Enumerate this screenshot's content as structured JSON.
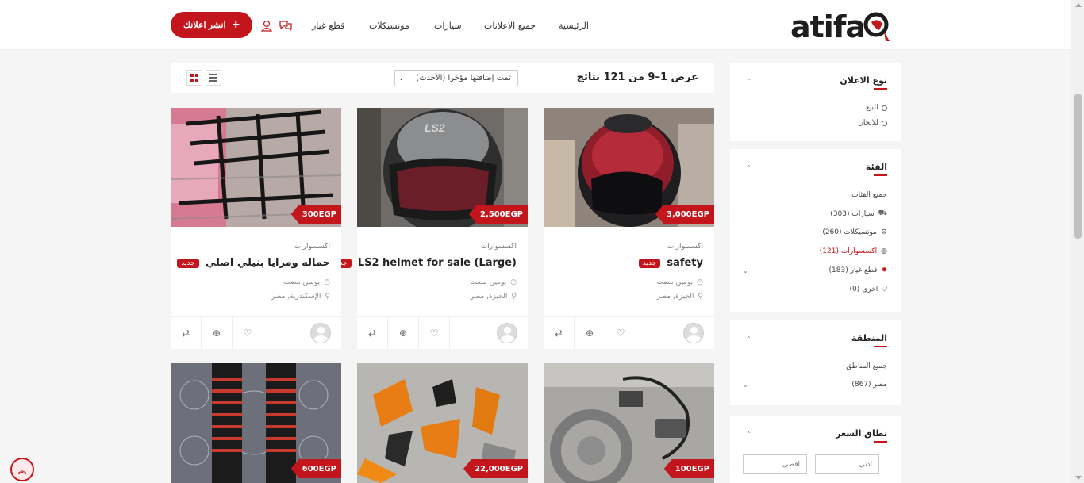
{
  "header": {
    "logo_text": "atifa",
    "nav": [
      "الرئيسية",
      "جميع الاعلانات",
      "سيارات",
      "موتسيكلات",
      "قطع غيار"
    ],
    "post_button": "انشر اعلانك"
  },
  "results": {
    "title": "عرض 1–9 من 121 نتائج",
    "sort_value": "تمت إضافتها مؤخرا (الأحدث)"
  },
  "cards": [
    {
      "category": "اكسسوارات",
      "title": "safety",
      "badge": "جديد",
      "time": "يومين مضت",
      "location": "الجيزة, مصر",
      "price": "3,000EGP"
    },
    {
      "category": "اكسسوارات",
      "title": "LS2 helmet for sale (Large)",
      "badge": "جديد",
      "time": "يومين مضت",
      "location": "الجيزة, مصر",
      "price": "2,500EGP"
    },
    {
      "category": "اكسسوارات",
      "title": "حماله ومرايا بنيلي اصلي",
      "badge": "جديد",
      "time": "يومين مضت",
      "location": "الإسكندرية, مصر",
      "price": "300EGP"
    }
  ],
  "cards_lower": [
    {
      "price": "100EGP"
    },
    {
      "price": "22,000EGP"
    },
    {
      "price": "600EGP"
    }
  ],
  "sidebar": {
    "ad_type": {
      "title": "نوع الاعلان",
      "options": [
        "للبيع",
        "للايجار"
      ]
    },
    "category": {
      "title": "الفئة",
      "all": "جميع الفئات",
      "items": [
        {
          "label": "سيارات (303)",
          "icon": "car-icon"
        },
        {
          "label": "موتسيكلات (260)",
          "icon": "motorcycle-icon"
        },
        {
          "label": "اكسسوارات (121)",
          "icon": "helmet-icon"
        },
        {
          "label": "قطع غيار (183)",
          "icon": "gear-icon"
        },
        {
          "label": "اخرى (0)",
          "icon": "cart-icon"
        }
      ]
    },
    "region": {
      "title": "المنطقة",
      "all": "جميع المناطق",
      "egypt": "مصر (867)"
    },
    "price_range": {
      "title": "نطاق السعر",
      "min_placeholder": "ادنى",
      "max_placeholder": "اقصى"
    }
  },
  "colors": {
    "accent": "#c3161c"
  }
}
